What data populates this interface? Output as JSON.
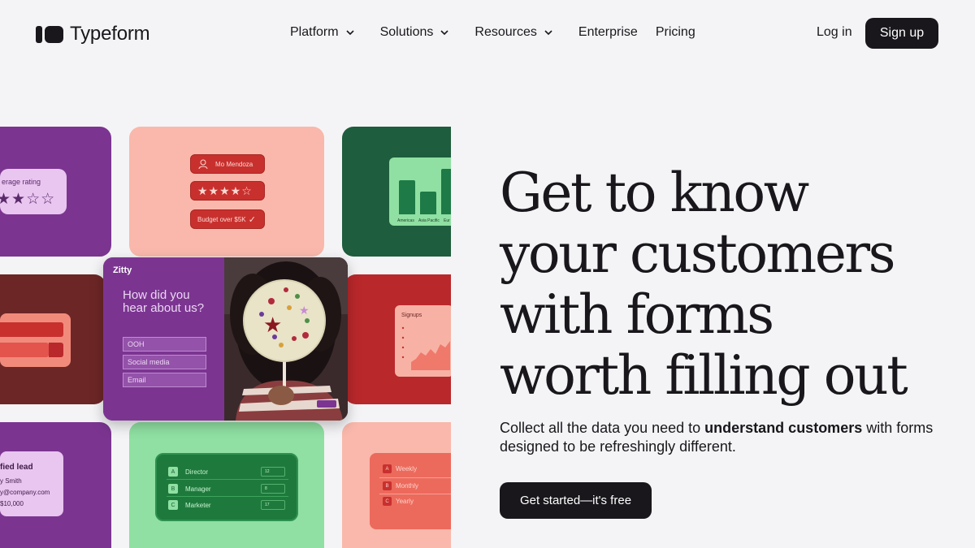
{
  "brand": {
    "name": "Typeform"
  },
  "nav": {
    "items": [
      {
        "label": "Platform",
        "has_menu": true
      },
      {
        "label": "Solutions",
        "has_menu": true
      },
      {
        "label": "Resources",
        "has_menu": true
      },
      {
        "label": "Enterprise",
        "has_menu": false
      },
      {
        "label": "Pricing",
        "has_menu": false
      }
    ],
    "login": "Log in",
    "signup": "Sign up"
  },
  "hero": {
    "headline_lines": [
      "Get to know",
      "your customers",
      "with forms",
      "worth filling out"
    ],
    "sub_pre": "Collect all the data you need to ",
    "sub_bold": "understand customers",
    "sub_post": " with forms designed to be refreshingly different.",
    "cta": "Get started—it's free"
  },
  "mosaic": {
    "rating": {
      "label": "erage rating",
      "stars": "★★☆☆",
      "value": 2
    },
    "profile": {
      "name": "Mo Mendoza",
      "stars": "★★★★☆",
      "rating": 4,
      "budget": "Budget over $5K"
    },
    "bar_chart": {
      "categories": [
        "Americas",
        "Asia Pacific",
        "Eur"
      ]
    },
    "signups": {
      "title": "Signups"
    },
    "feature_form": {
      "brand": "Zitty",
      "question": "How did you hear about us?",
      "options": [
        "OOH",
        "Social media",
        "Email"
      ]
    },
    "lead": {
      "title": "fied lead",
      "email": "y@company.com",
      "name": "y Smith",
      "amount": "$10,000"
    },
    "roles": [
      {
        "key": "A",
        "label": "Director",
        "count": "12"
      },
      {
        "key": "B",
        "label": "Manager",
        "count": "8"
      },
      {
        "key": "C",
        "label": "Marketer",
        "count": "17"
      }
    ],
    "frequency": [
      {
        "key": "A",
        "label": "Weekly"
      },
      {
        "key": "B",
        "label": "Monthly"
      },
      {
        "key": "C",
        "label": "Yearly"
      }
    ]
  },
  "colors": {
    "ink": "#19171c",
    "background": "#f4f4f6",
    "purple": "#7b3591",
    "coral": "#f9b8ab",
    "forest": "#1e5d3d",
    "red": "#b9282b",
    "mint": "#8fe0a2"
  }
}
